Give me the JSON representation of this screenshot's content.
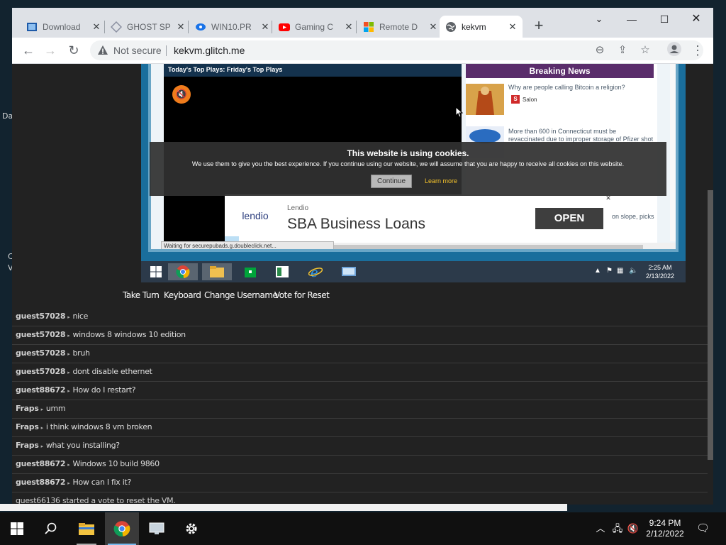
{
  "desktop": {
    "frag_left_top": "Da",
    "frag_left_mid1": "C",
    "frag_left_mid2": "V"
  },
  "browser": {
    "tabs": [
      {
        "title": "Download",
        "icon": "download-favicon"
      },
      {
        "title": "GHOST SP",
        "icon": "ghost-favicon"
      },
      {
        "title": "WIN10.PR",
        "icon": "win10-favicon"
      },
      {
        "title": "Gaming C",
        "icon": "youtube-favicon"
      },
      {
        "title": "Remote D",
        "icon": "microsoft-favicon"
      },
      {
        "title": "kekvm",
        "icon": "globe-favicon"
      }
    ],
    "omnibox": {
      "security_label": "Not secure",
      "url": "kekvm.glitch.me"
    }
  },
  "vm": {
    "video_title": "Today's Top Plays: Friday's Top Plays",
    "news": {
      "heading": "Breaking News",
      "item1": "Why are people calling Bitcoin a religion?",
      "item1_source": "Salon",
      "item2": "More than 600 in Connecticut must be revaccinated due to improper storage of Pfizer shot",
      "tail": "on slope, picks"
    },
    "cookie": {
      "title": "This website is using cookies.",
      "body": "We use them to give you the best experience. If you continue using our website, we will assume that you are happy to receive all cookies on this website.",
      "continue": "Continue",
      "learn_more": "Learn more"
    },
    "ad": {
      "logo": "lendio",
      "small": "Lendio",
      "headline": "SBA Business Loans",
      "cta": "OPEN"
    },
    "status_bar": "Waiting for securepubads.g.doubleclick.net...",
    "clock_time": "2:25 AM",
    "clock_date": "2/13/2022"
  },
  "controls": {
    "take_turn": "Take Turn",
    "keyboard": "Keyboard",
    "change_username": "Change Username",
    "vote_reset": "Vote for Reset"
  },
  "chat": [
    {
      "user": "guest57028",
      "msg": "nice"
    },
    {
      "user": "guest57028",
      "msg": "windows 8 windows 10 edition"
    },
    {
      "user": "guest57028",
      "msg": "bruh"
    },
    {
      "user": "guest57028",
      "msg": "dont disable ethernet"
    },
    {
      "user": "guest88672",
      "msg": "How do I restart?"
    },
    {
      "user": "Fraps",
      "msg": "umm"
    },
    {
      "user": "Fraps",
      "msg": "i think windows 8 vm broken"
    },
    {
      "user": "Fraps",
      "msg": "what you installing?"
    },
    {
      "user": "guest88672",
      "msg": "Windows 10 build 9860"
    },
    {
      "user": "guest88672",
      "msg": "How can I fix it?"
    }
  ],
  "chat_system": "guest66136 started a vote to reset the VM.",
  "taskbar": {
    "time": "9:24 PM",
    "date": "2/12/2022"
  }
}
